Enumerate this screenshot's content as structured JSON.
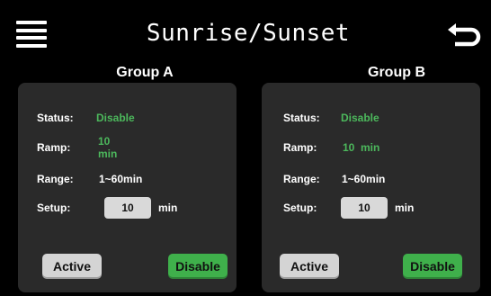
{
  "header": {
    "title": "Sunrise/Sunset"
  },
  "colors": {
    "accent_green": "#4cb85c",
    "panel_bg": "#2a2a2a",
    "active_button": "#d4d4d4",
    "disable_button": "#3fb04b"
  },
  "icons": {
    "menu": "hamburger-menu-icon",
    "back": "return-arrow-icon"
  },
  "groups": [
    {
      "title": "Group A",
      "status_label": "Status:",
      "status_value": "Disable",
      "ramp_label": "Ramp:",
      "ramp_value": "10 min",
      "range_label": "Range:",
      "range_value": "1~60min",
      "setup_label": "Setup:",
      "setup_value": "10",
      "setup_unit": "min",
      "active_label": "Active",
      "disable_label": "Disable"
    },
    {
      "title": "Group B",
      "status_label": "Status:",
      "status_value": "Disable",
      "ramp_label": "Ramp:",
      "ramp_value": "10  min",
      "range_label": "Range:",
      "range_value": "1~60min",
      "setup_label": "Setup:",
      "setup_value": "10",
      "setup_unit": "min",
      "active_label": "Active",
      "disable_label": "Disable"
    }
  ]
}
